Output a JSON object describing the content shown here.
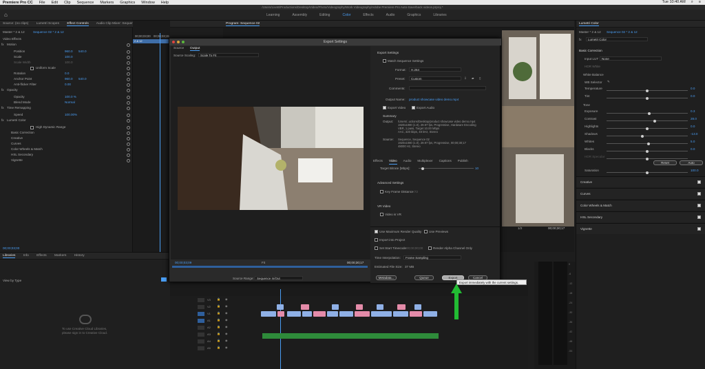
{
  "menubar": {
    "apple": "",
    "app": "Premiere Pro CC",
    "items": [
      "File",
      "Edit",
      "Clip",
      "Sequence",
      "Markers",
      "Graphics",
      "Window",
      "Help"
    ],
    "clock": "Tue 10:40 AM"
  },
  "titlebar": "/Users/LiveB/Productions/Desktop/Video/Photo/Videography/Work Videography/Adobe Premiere Pro Auto-Save/back videos.prproj *",
  "workspaces": [
    "Learning",
    "Assembly",
    "Editing",
    "Color",
    "Effects",
    "Audio",
    "Graphics",
    "Libraries"
  ],
  "active_workspace": "Color",
  "effect_controls": {
    "tabs": [
      "Source: (no clips)",
      "Lumetri Scopes",
      "Effect Controls",
      "Audio Clip Mixer: Sequence 02"
    ],
    "master": "Master * 2 & 12",
    "sequence": "Sequence 02 * 2 & 12",
    "timecodes": [
      "00;00;03;00",
      "00;00;03;15",
      "00;00;04;00"
    ],
    "clip_tag": "2 & 12",
    "section_video": "Video Effects",
    "rows": [
      {
        "name": "Motion",
        "type": "group"
      },
      {
        "name": "Position",
        "v1": "960.0",
        "v2": "540.0"
      },
      {
        "name": "Scale",
        "v1": "100.0"
      },
      {
        "name": "Scale Width",
        "v1": "100.0",
        "dim": true
      },
      {
        "name": "Uniform Scale",
        "type": "check"
      },
      {
        "name": "Rotation",
        "v1": "0.0"
      },
      {
        "name": "Anchor Point",
        "v1": "960.0",
        "v2": "540.0"
      },
      {
        "name": "Anti-flicker Filter",
        "v1": "0.00"
      },
      {
        "name": "Opacity",
        "type": "group"
      },
      {
        "name": "Opacity",
        "v1": "100.0 %"
      },
      {
        "name": "Blend Mode",
        "v1": "Normal"
      },
      {
        "name": "Time Remapping",
        "type": "group"
      },
      {
        "name": "Speed",
        "v1": "100.00%"
      },
      {
        "name": "Lumetri Color",
        "type": "group"
      },
      {
        "name": "High Dynamic Range",
        "type": "check"
      },
      {
        "name": "Basic Correction",
        "type": "sub"
      },
      {
        "name": "Creative",
        "type": "sub"
      },
      {
        "name": "Curves",
        "type": "sub"
      },
      {
        "name": "Color Wheels & Match",
        "type": "sub"
      },
      {
        "name": "HSL Secondary",
        "type": "sub"
      },
      {
        "name": "Vignette",
        "type": "sub"
      }
    ],
    "bottom_timecode": "00;00;03;00"
  },
  "program": {
    "title": "Program: Sequence 02",
    "fraction": "1/2",
    "end_timecode": "00;00;30;17"
  },
  "libraries": {
    "tabs": [
      "Libraries",
      "Info",
      "Effects",
      "Markers",
      "History"
    ],
    "view_by": "View by Type",
    "signin_line1": "To use Creative Cloud Libraries,",
    "signin_line2": "please sign in to Creative Cloud."
  },
  "lumetri": {
    "title": "Lumetri Color",
    "master": "Master * 2 & 12",
    "sequence": "Sequence 02 * 2 & 12",
    "effect": "Lumetri Color",
    "basic": "Basic Correction",
    "input_lut_label": "Input LUT",
    "input_lut": "None",
    "hdr_white": "HDR White",
    "white_balance": "White Balance",
    "wb_selector": "WB Selector",
    "sliders_wb": [
      {
        "name": "Temperature",
        "value": "0.0",
        "pos": 0.5
      },
      {
        "name": "Tint",
        "value": "0.0",
        "pos": 0.5
      }
    ],
    "tone": "Tone",
    "sliders_tone": [
      {
        "name": "Exposure",
        "value": "0.3",
        "pos": 0.53
      },
      {
        "name": "Contrast",
        "value": "28.0",
        "pos": 0.6
      },
      {
        "name": "Highlights",
        "value": "0.0",
        "pos": 0.5
      },
      {
        "name": "Shadows",
        "value": "-13.0",
        "pos": 0.44
      },
      {
        "name": "Whites",
        "value": "5.0",
        "pos": 0.52
      },
      {
        "name": "Blacks",
        "value": "0.0",
        "pos": 0.5
      },
      {
        "name": "HDR Specular",
        "value": "",
        "pos": 0.5
      }
    ],
    "reset": "Reset",
    "auto": "Auto",
    "saturation": {
      "name": "Saturation",
      "value": "100.0",
      "pos": 0.5
    },
    "sections": [
      "Creative",
      "Curves",
      "Color Wheels & Match",
      "HSL Secondary",
      "Vignette"
    ]
  },
  "dialog": {
    "title": "Export Settings",
    "tabs": [
      "Source",
      "Output"
    ],
    "scaling_label": "Source Scaling:",
    "scaling": "Scale To Fit",
    "timecode_in": "00;00;03;09",
    "fit": "Fit",
    "timecode_out": "00;00;30;17",
    "source_range_label": "Source Range:",
    "source_range": "Sequence In/Out",
    "export_settings": "Export Settings",
    "match_seq": "Match Sequence Settings",
    "format_label": "Format:",
    "format": "H.264",
    "preset_label": "Preset:",
    "preset": "Custom",
    "comments_label": "Comments:",
    "output_name_label": "Output Name:",
    "output_name": "product showcase video demo.mp4",
    "export_video": "Export Video",
    "export_audio": "Export Audio",
    "summary": "Summary",
    "output_label": "Output:",
    "output_lines": [
      "/Users/..uctions/Desktop/product showcase video demo.mp4",
      "1920x1080 (1.0), 29.97 fps, Progressive, Hardware Encoding",
      "VBR, 1 pass, Target 10.00 Mbps",
      "AAC, 320 kbps, 48 kHz, Stereo"
    ],
    "source_label": "Source:",
    "source_lines": [
      "Sequence, Sequence 02",
      "1920x1080 (1.0), 29.97 fps, Progressive, 00;00;30;17",
      "48000 Hz, Stereo"
    ],
    "subtabs": [
      "Effects",
      "Video",
      "Audio",
      "Multiplexer",
      "Captions",
      "Publish"
    ],
    "active_subtab": "Video",
    "target_bitrate": "Target Bitrate [Mbps]:",
    "target_value": "10",
    "advanced": "Advanced Settings",
    "keyframe": "Key Frame Distance:",
    "keyframe_value": "72",
    "vr_video": "VR Video",
    "video_is_vr": "Video is VR",
    "max_render": "Use Maximum Render Quality",
    "use_previews": "Use Previews",
    "import_project": "Import into Project",
    "set_start_tc": "Set Start Timecode",
    "start_tc": "00;00;00;00",
    "render_alpha": "Render Alpha Channel Only",
    "time_interp_label": "Time Interpolation:",
    "time_interp": "Frame Sampling",
    "file_size_label": "Estimated File Size:",
    "file_size": "37 MB",
    "metadata": "Metadata...",
    "queue": "Queue",
    "export": "Export",
    "cancel": "Cancel"
  },
  "tooltip": "Export immediately with the current settings.",
  "timeline": {
    "tracks_video": [
      "V3",
      "V2",
      "V1"
    ],
    "tracks_audio": [
      "A1",
      "A2",
      "A3",
      "A4",
      "A5"
    ],
    "meter_labels": [
      "0",
      "-6",
      "-12",
      "-18",
      "-24",
      "-30",
      "-36",
      "-42",
      "-48",
      "-54"
    ]
  },
  "colors": {
    "accent": "#4a9ef5",
    "clip_blue": "#8fb0e6",
    "clip_pink": "#e48ba9",
    "audio_green": "#2e8b3a",
    "arrow_green": "#22bb33"
  }
}
